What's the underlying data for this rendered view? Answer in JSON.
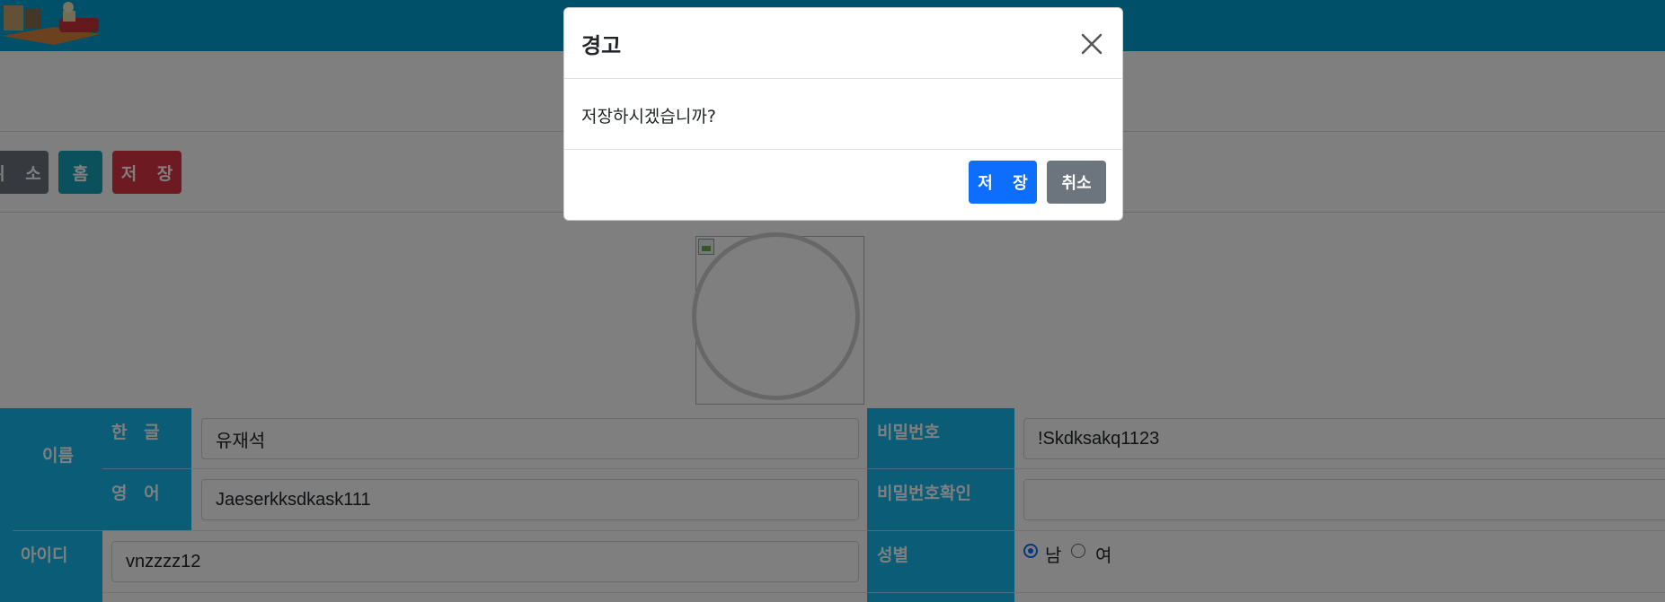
{
  "toolbar": {
    "cancel_label": "취 소",
    "home_label": "홈",
    "save_label": "저 장"
  },
  "form": {
    "name_label": "이름",
    "korean_label": "한 글",
    "korean_value": "유재석",
    "english_label": "영 어",
    "english_value": "Jaeserkksdkask111",
    "id_label": "아이디",
    "id_value": "vnzzzz12",
    "password_label": "비밀번호",
    "password_value": "!Skdksakq1123",
    "password_confirm_label": "비밀번호확인",
    "password_confirm_value": "",
    "gender_label": "성별",
    "gender_options": [
      "남",
      "여"
    ],
    "gender_selected": "남"
  },
  "modal": {
    "title": "경고",
    "message": "저장하시겠습니까?",
    "save_label": "저 장",
    "cancel_label": "취소"
  },
  "icons": {
    "close": "close-icon",
    "logo": "logo-icon",
    "broken_image": "broken-image-icon"
  },
  "colors": {
    "header": "#00a0d2",
    "cell_head": "#15b9ee",
    "btn_secondary": "#6c757d",
    "btn_info": "#17a2b8",
    "btn_danger": "#dc3545",
    "btn_primary": "#0d6efd"
  }
}
